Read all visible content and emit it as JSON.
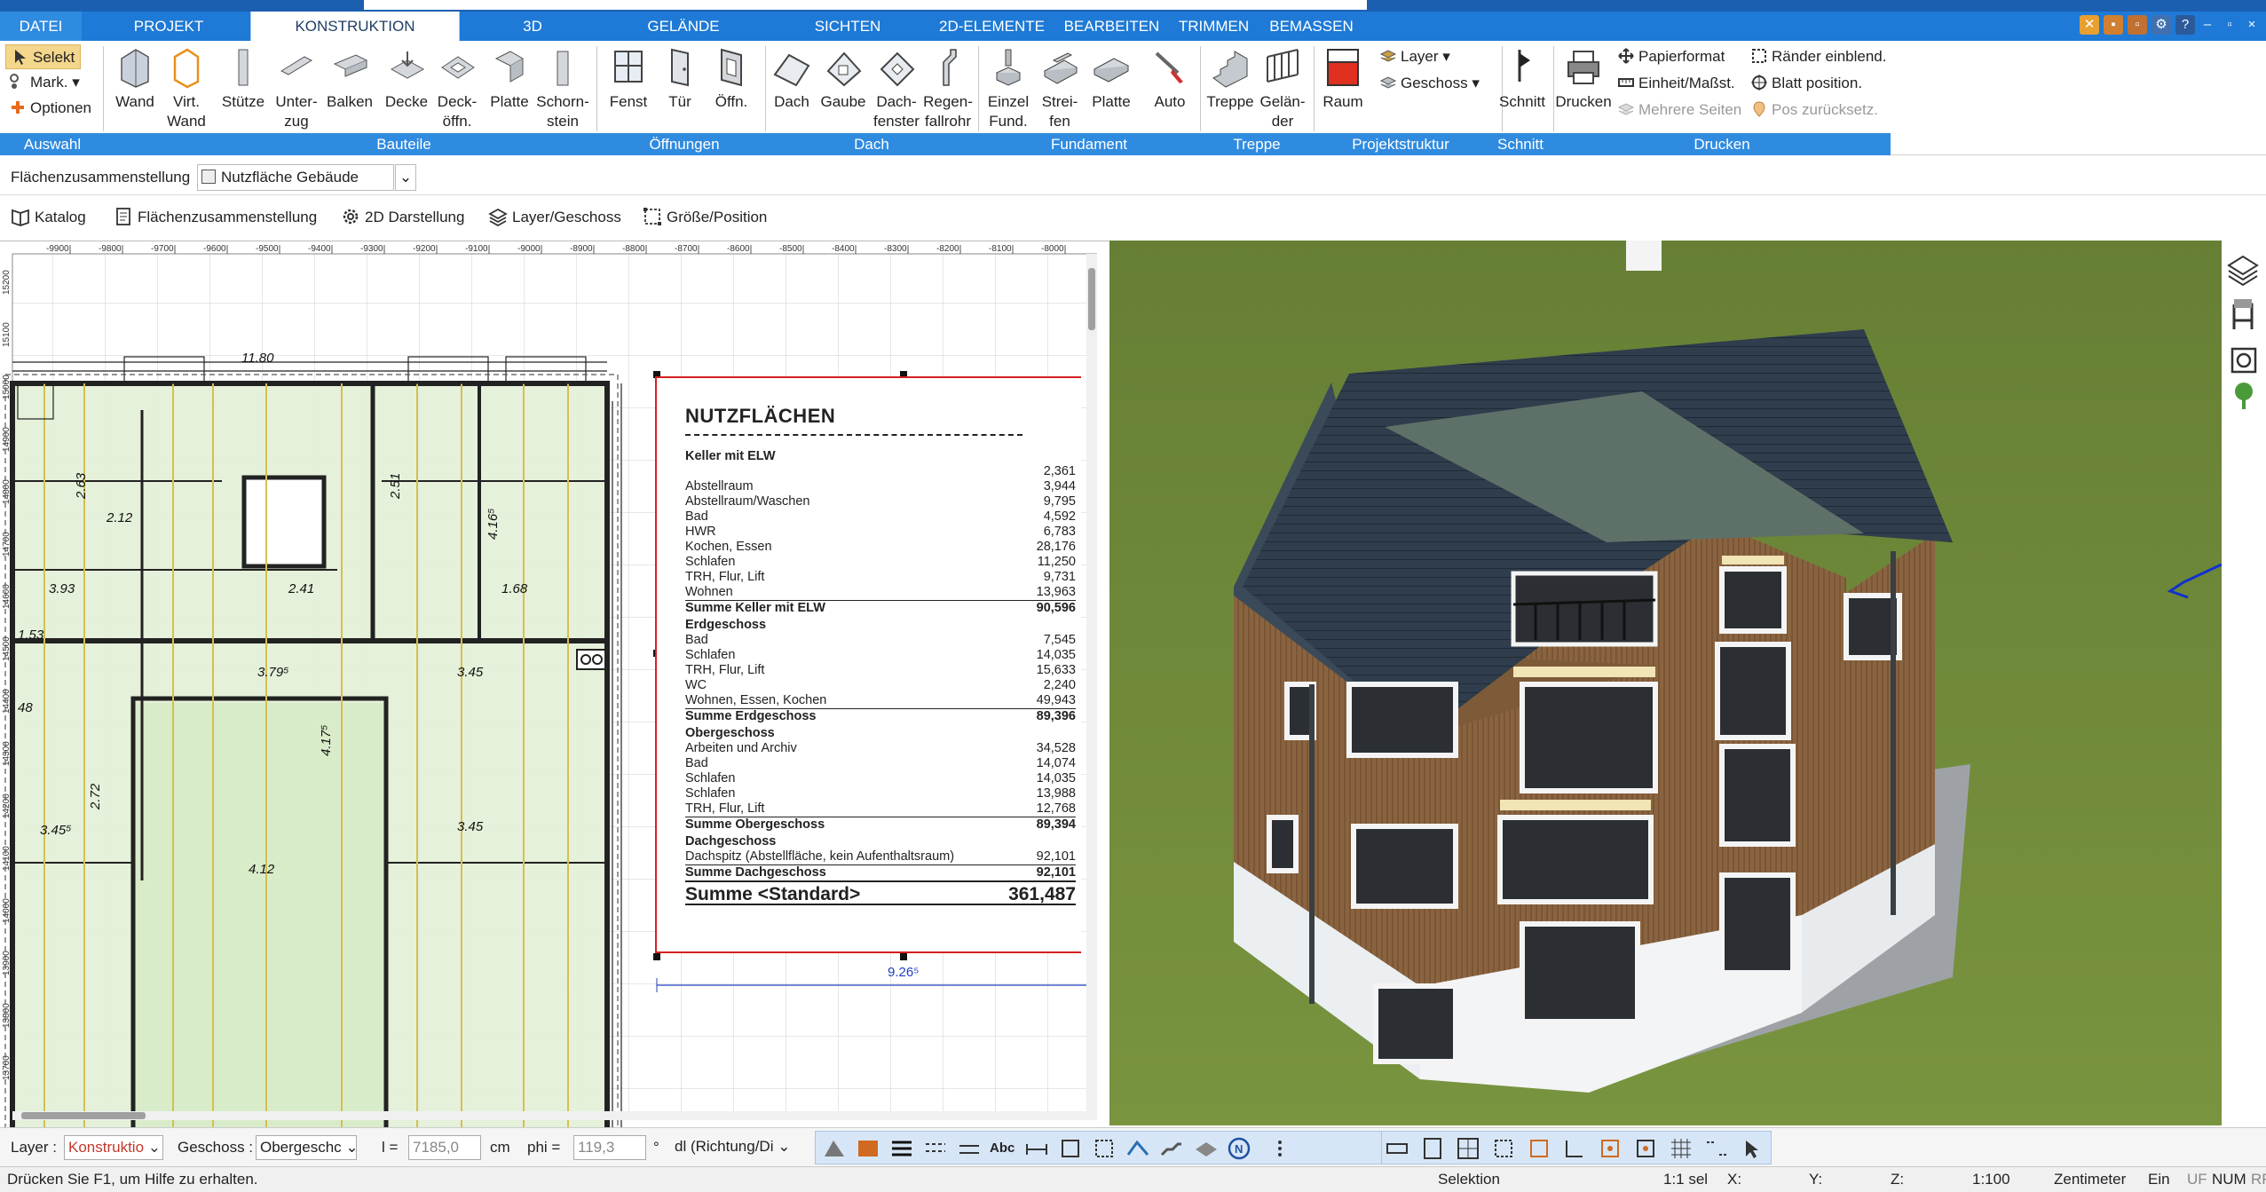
{
  "tabs": {
    "datei": "DATEI",
    "projekt": "PROJEKT",
    "konstruktion": "KONSTRUKTION",
    "drei_d": "3D",
    "gelaende": "GELÄNDE",
    "sichten": "SICHTEN",
    "elemente_2d": "2D-ELEMENTE",
    "bearbeiten": "BEARBEITEN",
    "trimmen": "TRIMMEN",
    "bemassen": "BEMASSEN"
  },
  "ribbon": {
    "auswahl": {
      "selekt": "Selekt",
      "mark": "Mark.",
      "optionen": "Optionen",
      "group": "Auswahl"
    },
    "bauteile": {
      "wand": "Wand",
      "virt_wand_1": "Virt.",
      "virt_wand_2": "Wand",
      "stuetze": "Stütze",
      "unterzug_1": "Unter-",
      "unterzug_2": "zug",
      "balken": "Balken",
      "decke": "Decke",
      "deckoeffn_1": "Deck-",
      "deckoeffn_2": "öffn.",
      "platte": "Platte",
      "schornstein_1": "Schorn-",
      "schornstein_2": "stein",
      "group": "Bauteile"
    },
    "oeffnungen": {
      "fenst": "Fenst",
      "tuer": "Tür",
      "oeffn": "Öffn.",
      "group": "Öffnungen"
    },
    "dach": {
      "dach": "Dach",
      "gaube": "Gaube",
      "dachfenster_1": "Dach-",
      "dachfenster_2": "fenster",
      "regenfallrohr_1": "Regen-",
      "regenfallrohr_2": "fallrohr",
      "group": "Dach"
    },
    "fundament": {
      "einzel_1": "Einzel",
      "einzel_2": "Fund.",
      "streifen_1": "Strei-",
      "streifen_2": "fen",
      "platte": "Platte",
      "auto": "Auto",
      "group": "Fundament"
    },
    "treppe": {
      "treppe": "Treppe",
      "gelaender_1": "Gelän-",
      "gelaender_2": "der",
      "group": "Treppe"
    },
    "projektstruktur": {
      "raum": "Raum",
      "layer": "Layer",
      "geschoss": "Geschoss",
      "group": "Projektstruktur"
    },
    "schnitt": {
      "schnitt": "Schnitt",
      "group": "Schnitt"
    },
    "drucken": {
      "drucken": "Drucken",
      "papierformat": "Papierformat",
      "einheit": "Einheit/Maßst.",
      "mehrere_seiten": "Mehrere Seiten",
      "raender": "Ränder einblend.",
      "blatt": "Blatt position.",
      "pos": "Pos zurücksetz.",
      "group": "Drucken"
    }
  },
  "context_bar": {
    "label": "Flächenzusammenstellung",
    "dropdown_value": "Nutzfläche Gebäude"
  },
  "toolbar2": {
    "katalog": "Katalog",
    "flaechen": "Flächenzusammenstellung",
    "darstellung": "2D Darstellung",
    "layer": "Layer/Geschoss",
    "groesse": "Größe/Position"
  },
  "ruler_top": [
    "-9900",
    "-9800",
    "-9700",
    "-9600",
    "-9500",
    "-9400",
    "-9300",
    "-9200",
    "-9100",
    "-9000",
    "-8900",
    "-8800",
    "-8700",
    "-8600",
    "-8500",
    "-8400",
    "-8300",
    "-8200",
    "-8100",
    "-8000"
  ],
  "ruler_left": [
    "15200",
    "15100",
    "15000",
    "14900",
    "14800",
    "14700",
    "14600",
    "14500",
    "14400",
    "14300",
    "14200",
    "14100",
    "14000",
    "13900",
    "13800",
    "13700"
  ],
  "plan_dims": {
    "top": "11.80",
    "bottom_right": "9.26⁵",
    "r1": "3.93",
    "r2": "2.12",
    "r3": "2.41",
    "r4": "1.68",
    "r5": "3.79⁵",
    "r6": "3.45",
    "r7": "3.45⁵",
    "r8": "4.12",
    "r9": "3.45",
    "r10": "4.17⁵",
    "r11": "4.16⁵",
    "r12": "1.53",
    "r13": "48",
    "r14": "2.51",
    "r15": "2.63",
    "r16": "2.72"
  },
  "nutzflaechen": {
    "title": "NUTZFLÄCHEN",
    "first_value": "2,361",
    "sections": [
      {
        "header": "Keller mit ELW",
        "rows": [
          [
            "Abstellraum",
            "3,944"
          ],
          [
            "Abstellraum/Waschen",
            "9,795"
          ],
          [
            "Bad",
            "4,592"
          ],
          [
            "HWR",
            "6,783"
          ],
          [
            "Kochen, Essen",
            "28,176"
          ],
          [
            "Schlafen",
            "11,250"
          ],
          [
            "TRH, Flur, Lift",
            "9,731"
          ],
          [
            "Wohnen",
            "13,963"
          ]
        ],
        "sum_label": "Summe Keller mit ELW",
        "sum_value": "90,596"
      },
      {
        "header": "Erdgeschoss",
        "rows": [
          [
            "Bad",
            "7,545"
          ],
          [
            "Schlafen",
            "14,035"
          ],
          [
            "TRH, Flur, Lift",
            "15,633"
          ],
          [
            "WC",
            "2,240"
          ],
          [
            "Wohnen, Essen, Kochen",
            "49,943"
          ]
        ],
        "sum_label": "Summe Erdgeschoss",
        "sum_value": "89,396"
      },
      {
        "header": "Obergeschoss",
        "rows": [
          [
            "Arbeiten und Archiv",
            "34,528"
          ],
          [
            "Bad",
            "14,074"
          ],
          [
            "Schlafen",
            "14,035"
          ],
          [
            "Schlafen",
            "13,988"
          ],
          [
            "TRH, Flur, Lift",
            "12,768"
          ]
        ],
        "sum_label": "Summe Obergeschoss",
        "sum_value": "89,394"
      },
      {
        "header": "Dachgeschoss",
        "rows": [
          [
            "Dachspitz (Abstellfläche, kein Aufenthaltsraum)",
            "92,101"
          ]
        ],
        "sum_label": "Summe Dachgeschoss",
        "sum_value": "92,101"
      }
    ],
    "total_label": "Summe <Standard>",
    "total_value": "361,487"
  },
  "bottombar": {
    "layer_label": "Layer :",
    "layer_value": "Konstruktio",
    "geschoss_label": "Geschoss :",
    "geschoss_value": "Obergeschc",
    "l_label": "l =",
    "l_value": "7185,0",
    "l_unit": "cm",
    "phi_label": "phi =",
    "phi_value": "119,3",
    "phi_unit": "°",
    "dl_value": "dl (Richtung/Di"
  },
  "statusbar": {
    "help": "Drücken Sie F1, um Hilfe zu erhalten.",
    "mode": "Selektion",
    "sel": "1:1 sel",
    "x": "X:",
    "y": "Y:",
    "z": "Z:",
    "scale": "1:100",
    "unit": "Zentimeter",
    "ein": "Ein",
    "uf": "UF",
    "num": "NUM",
    "rf": "RF"
  },
  "colors": {
    "accent": "#1e7ad6",
    "ribbon_group": "#2f8be0",
    "selection_red": "#d62020",
    "grass": "#6f8a3a"
  }
}
